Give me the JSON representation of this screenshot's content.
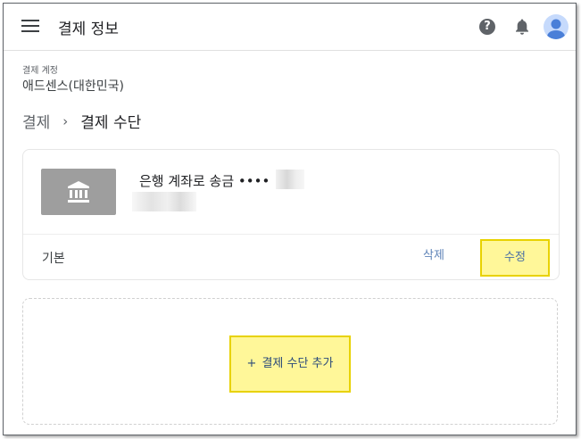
{
  "header": {
    "title": "결제 정보",
    "help_symbol": "?"
  },
  "account": {
    "label": "결제 계정",
    "value": "애드센스(대한민국)"
  },
  "breadcrumb": {
    "parent": "결제",
    "separator": "›",
    "current": "결제 수단"
  },
  "payment_method": {
    "name": "은행 계좌로 송금 ••••",
    "status": "기본",
    "delete_label": "삭제",
    "edit_label": "수정",
    "icon": "bank-icon"
  },
  "add_method": {
    "plus": "+",
    "label": "결제 수단 추가"
  },
  "colors": {
    "highlight_fill": "#fff799",
    "highlight_border": "#e8d200",
    "link_blue": "#5f84b8",
    "bank_tile": "#9e9e9e"
  }
}
